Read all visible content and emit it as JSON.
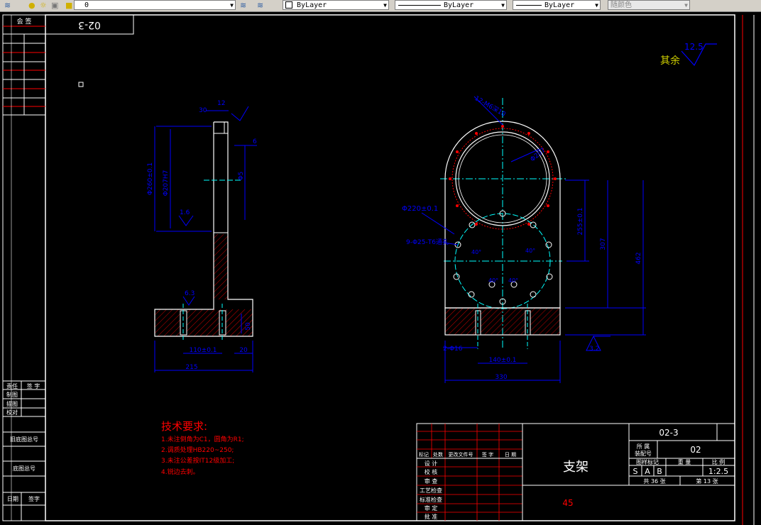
{
  "toolbar": {
    "layer_value": "0",
    "color_value": "ByLayer",
    "linetype_value": "ByLayer",
    "lineweight_value": "ByLayer",
    "plotstyle_value": "随颜色"
  },
  "drawing": {
    "mirror_code": "02-3",
    "roughness_other_label": "其余",
    "roughness_other_value": "12.5",
    "side_view": {
      "dim_top_30": "30",
      "dim_top_12": "12",
      "dim_6": "6",
      "dim_phi260": "Φ260±0.1",
      "dim_phi207": "Φ207H7",
      "dim_phi5": "Φ5",
      "rough_1_6": "1.6",
      "rough_6_3": "6.3",
      "dim_50": "50",
      "dim_110": "110±0.1",
      "dim_20": "20",
      "dim_215": "215"
    },
    "front_view": {
      "holes_12": "12-M6深10",
      "dim_phi207": "Φ207",
      "dim_phi220": "Φ220±0.1",
      "holes_9": "9-Φ25-T6通孔",
      "dim_330": "330",
      "dim_140": "140±0.1",
      "dim_phi16": "2-Φ16",
      "dim_255": "255±0.1",
      "dim_307": "307",
      "dim_462": "462",
      "rough_3_2": "3.2",
      "ang_40a": "40°",
      "ang_40b": "40°",
      "ang_40c": "40°",
      "ang_40d": "40°"
    },
    "tech_req": {
      "title": "技术要求:",
      "items": [
        "1.未注倒角为C1，圆角为R1;",
        "2.调质处理HB220~250;",
        "3.未注公差按IT12级加工;",
        "4.锐边去刺。"
      ]
    },
    "left_table": {
      "huiqian": "会 签",
      "zeren": "责任",
      "qianzi": "签 字",
      "zhitu": "制图",
      "miaotu": "描图",
      "jiaodui": "校对",
      "jiudi": "旧底图总号",
      "ditu": "底图总号",
      "riqi": "日期",
      "qianzi2": "签字"
    },
    "title_block": {
      "part_name": "支架",
      "material": "45",
      "drawing_no": "02-3",
      "belong_label": "所 属",
      "belong_label2": "装配号",
      "belong_value": "02",
      "stage_label": "图样标记",
      "weight_label": "重 量",
      "scale_label": "比 例",
      "stage_s": "S",
      "stage_a": "A",
      "stage_b": "B",
      "scale_value": "1:2.5",
      "total_label": "共 36 张",
      "sheet_label": "第 13 张",
      "hdr_mark": "标记",
      "hdr_count": "处数",
      "hdr_file": "更改文件号",
      "hdr_sign": "签 字",
      "hdr_date": "日 期",
      "row_design": "设 计",
      "row_check": "校 核",
      "row_review": "审 查",
      "row_craft": "工艺检查",
      "row_std": "标准检查",
      "row_audit": "审 定",
      "row_approve": "批 准"
    }
  },
  "colors": {
    "background": "#000000",
    "frame": "#ffffff",
    "dimension": "#0000ff",
    "centerline": "#00ffff",
    "red": "#ff0000",
    "table_red": "#ff0000"
  }
}
